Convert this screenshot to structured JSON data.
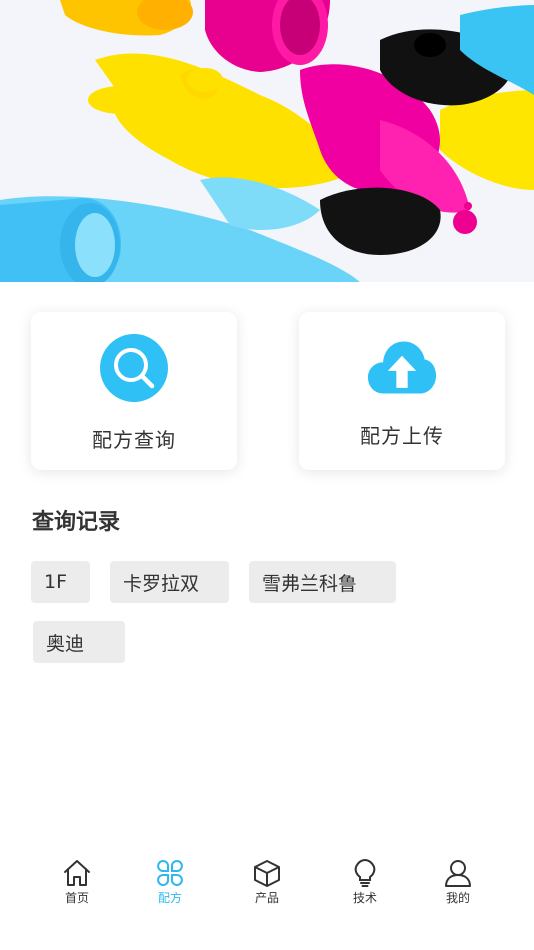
{
  "hero": {
    "image_name": "paint-splash-banner"
  },
  "actions": {
    "query_label": "配方查询",
    "upload_label": "配方上传"
  },
  "history": {
    "title": "查询记录",
    "tags": [
      "1F",
      "卡罗拉双",
      "雪弗兰科鲁",
      "奥迪"
    ]
  },
  "tabbar": {
    "items": [
      {
        "label": "首页",
        "icon": "home-icon"
      },
      {
        "label": "配方",
        "icon": "grid-icon",
        "active": true
      },
      {
        "label": "产品",
        "icon": "cube-icon"
      },
      {
        "label": "技术",
        "icon": "lightbulb-icon"
      },
      {
        "label": "我的",
        "icon": "user-icon"
      }
    ]
  },
  "colors": {
    "accent": "#2fb8f0",
    "tag_bg": "#ececec",
    "text": "#333333"
  }
}
